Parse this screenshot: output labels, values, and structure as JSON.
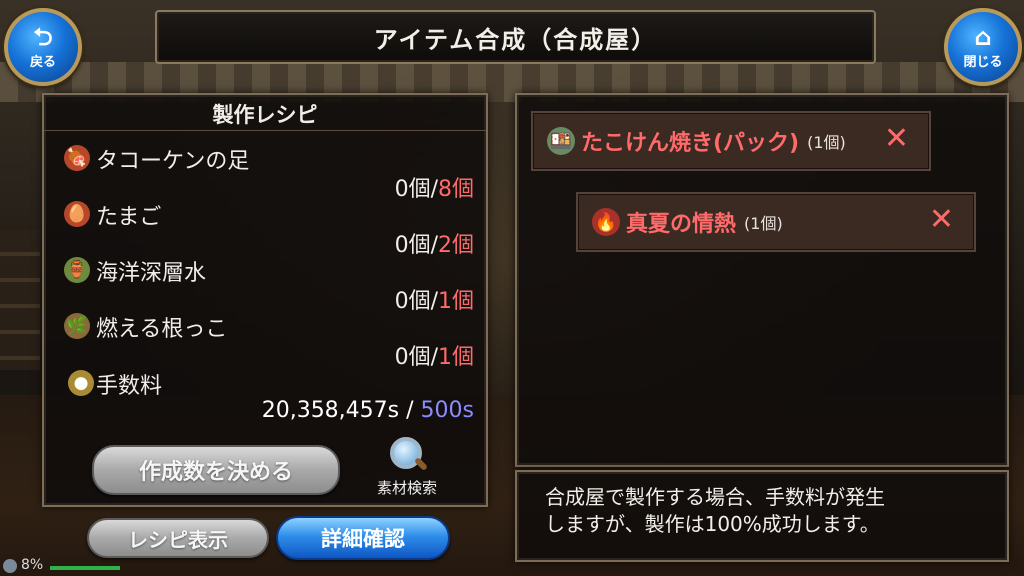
{
  "header": {
    "title": "アイテム合成（合成屋）",
    "back_label": "戻る",
    "close_label": "閉じる"
  },
  "recipe": {
    "heading": "製作レシピ",
    "ingredients": [
      {
        "name": "タコーケンの足",
        "have": "0個",
        "sep": "/",
        "need": "8個",
        "icon": "meat-icon"
      },
      {
        "name": "たまご",
        "have": "0個",
        "sep": "/",
        "need": "2個",
        "icon": "egg-icon"
      },
      {
        "name": "海洋深層水",
        "have": "0個",
        "sep": "/",
        "need": "1個",
        "icon": "water-jar-icon"
      },
      {
        "name": "燃える根っこ",
        "have": "0個",
        "sep": "/",
        "need": "1個",
        "icon": "root-icon"
      }
    ],
    "fee": {
      "label": "手数料",
      "owned": "20,358,457s",
      "sep": " / ",
      "cost": "500s",
      "icon": "coins-icon"
    },
    "decide_button": "作成数を決める",
    "search_label": "素材検索"
  },
  "bottom_buttons": {
    "recipe_show": "レシピ表示",
    "detail": "詳細確認"
  },
  "results": [
    {
      "name": "たこけん焼き(パック)",
      "count": "(1個)",
      "icon": "food-pack-icon",
      "remove": "✕"
    },
    {
      "name": "真夏の情熱",
      "count": "(1個)",
      "icon": "flame-crystal-icon",
      "remove": "✕"
    }
  ],
  "message": {
    "line1": "合成屋で製作する場合、手数料が発生",
    "line2": "しますが、製作は100%成功します。"
  },
  "status": {
    "percent": "8%"
  },
  "colors": {
    "need_red": "#ff6a6a",
    "cost_blue": "#8a8cff",
    "primary_button": "#2e8eea"
  }
}
